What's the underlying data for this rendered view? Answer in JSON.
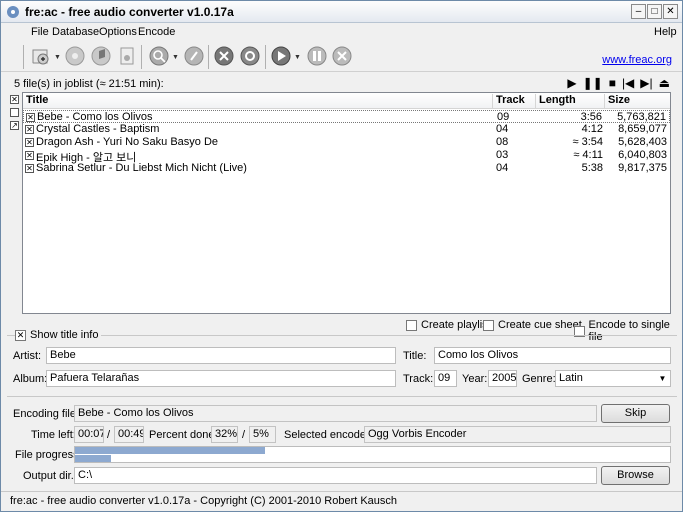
{
  "window": {
    "title": "fre:ac - free audio converter v1.0.17a"
  },
  "menu": {
    "file": "File",
    "database": "Database",
    "options": "Options",
    "encode": "Encode",
    "help": "Help"
  },
  "toolbar": {
    "icons": [
      "add-files-icon",
      "cddb-query-icon",
      "cd-rip-icon",
      "file-info-icon",
      "search-icon",
      "encoder-icon",
      "tools-icon",
      "settings-icon",
      "play-encode-icon",
      "pause-icon",
      "stop-icon"
    ],
    "link": "www.freac.org"
  },
  "joblist": {
    "summary": "5 file(s) in joblist (≈ 21:51 min):",
    "columns": {
      "title": "Title",
      "track": "Track",
      "length": "Length",
      "size": "Size"
    },
    "rows": [
      {
        "title": "Bebe - Como los Olivos",
        "track": "09",
        "length": "3:56",
        "size": "5,763,821",
        "checked": true,
        "selected": true
      },
      {
        "title": "Crystal Castles - Baptism",
        "track": "04",
        "length": "4:12",
        "size": "8,659,077",
        "checked": true,
        "selected": false
      },
      {
        "title": "Dragon Ash - Yuri No Saku Basyo De",
        "track": "08",
        "length": "≈ 3:54",
        "size": "5,628,403",
        "checked": true,
        "selected": false
      },
      {
        "title": "Epik High - 알고 보니",
        "track": "03",
        "length": "≈ 4:11",
        "size": "6,040,803",
        "checked": true,
        "selected": false
      },
      {
        "title": "Sabrina Setlur - Du Liebst Mich Nicht (Live)",
        "track": "04",
        "length": "5:38",
        "size": "9,817,375",
        "checked": true,
        "selected": false
      }
    ]
  },
  "options": {
    "create_playlist": "Create playlist",
    "create_cue_sheet": "Create cue sheet",
    "encode_single": "Encode to single file",
    "show_title_info": "Show title info"
  },
  "titleinfo": {
    "artist_label": "Artist:",
    "artist": "Bebe",
    "title_label": "Title:",
    "title": "Como los Olivos",
    "album_label": "Album:",
    "album": "Pafuera Telarañas",
    "track_label": "Track:",
    "track": "09",
    "year_label": "Year:",
    "year": "2005",
    "genre_label": "Genre:",
    "genre": "Latin"
  },
  "encoding": {
    "file_label": "Encoding file:",
    "file": "Bebe - Como los Olivos",
    "skip": "Skip",
    "time_left_label": "Time left:",
    "time_left": "00:07",
    "slash1": "/",
    "time_total": "00:49",
    "percent_label": "Percent done:",
    "percent": "32%",
    "slash2": "/",
    "percent_total": "5%",
    "encoder_label": "Selected encoder:",
    "encoder": "Ogg Vorbis Encoder",
    "file_progress_label": "File progress:",
    "file_progress": 0.32,
    "total_progress": 0.06,
    "output_label": "Output dir.:",
    "output": "C:\\",
    "browse": "Browse"
  },
  "status": "fre:ac - free audio converter v1.0.17a - Copyright (C) 2001-2010 Robert Kausch"
}
